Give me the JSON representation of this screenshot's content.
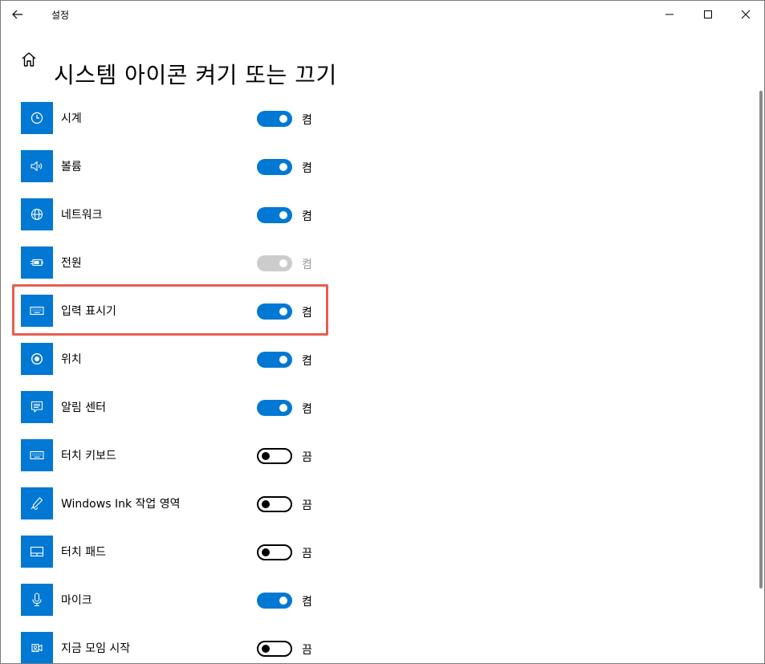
{
  "window": {
    "title": "설정",
    "controls": {
      "minimize_icon": "minimize-icon",
      "maximize_icon": "maximize-icon",
      "close_icon": "close-icon"
    }
  },
  "header": {
    "home_icon": "home-icon",
    "title": "시스템 아이콘 켜기 또는 끄기"
  },
  "colors": {
    "accent": "#0078d4",
    "highlight_border": "#ea5d4f",
    "disabled_toggle": "#cccccc"
  },
  "items": [
    {
      "label": "시계",
      "icon": "clock-icon",
      "state": "on",
      "state_label": "켬"
    },
    {
      "label": "볼륨",
      "icon": "volume-icon",
      "state": "on",
      "state_label": "켬"
    },
    {
      "label": "네트워크",
      "icon": "network-globe-icon",
      "state": "on",
      "state_label": "켬"
    },
    {
      "label": "전원",
      "icon": "battery-power-icon",
      "state": "disabled",
      "state_label": "켬"
    },
    {
      "label": "입력 표시기",
      "icon": "keyboard-icon",
      "state": "on",
      "state_label": "켬",
      "highlighted": true
    },
    {
      "label": "위치",
      "icon": "location-icon",
      "state": "on",
      "state_label": "켬"
    },
    {
      "label": "알림 센터",
      "icon": "action-center-icon",
      "state": "on",
      "state_label": "켬"
    },
    {
      "label": "터치 키보드",
      "icon": "touch-keyboard-icon",
      "state": "off",
      "state_label": "끔"
    },
    {
      "label": "Windows Ink 작업 영역",
      "icon": "pen-ink-icon",
      "state": "off",
      "state_label": "끔"
    },
    {
      "label": "터치 패드",
      "icon": "touchpad-icon",
      "state": "off",
      "state_label": "끔"
    },
    {
      "label": "마이크",
      "icon": "microphone-icon",
      "state": "on",
      "state_label": "켬"
    },
    {
      "label": "지금 모임 시작",
      "icon": "meet-now-icon",
      "state": "off",
      "state_label": "끔"
    }
  ]
}
